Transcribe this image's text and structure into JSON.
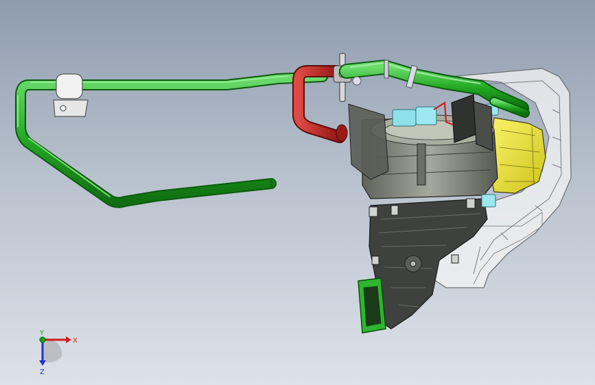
{
  "colors": {
    "hose_green": "#1fa81f",
    "hose_green_light": "#5fd35f",
    "hose_red": "#c8201c",
    "housing_yellow": "#f2ea2a",
    "motor_gray": "#7f8378",
    "case_dark": "#3f423f",
    "transparent_shell": "#f4f4f4"
  },
  "triad": {
    "x_label": "X",
    "y_label": "Y",
    "z_label": "Z",
    "x_color": "#d21c1c",
    "y_color": "#1aa51a",
    "z_color": "#2233cc"
  }
}
